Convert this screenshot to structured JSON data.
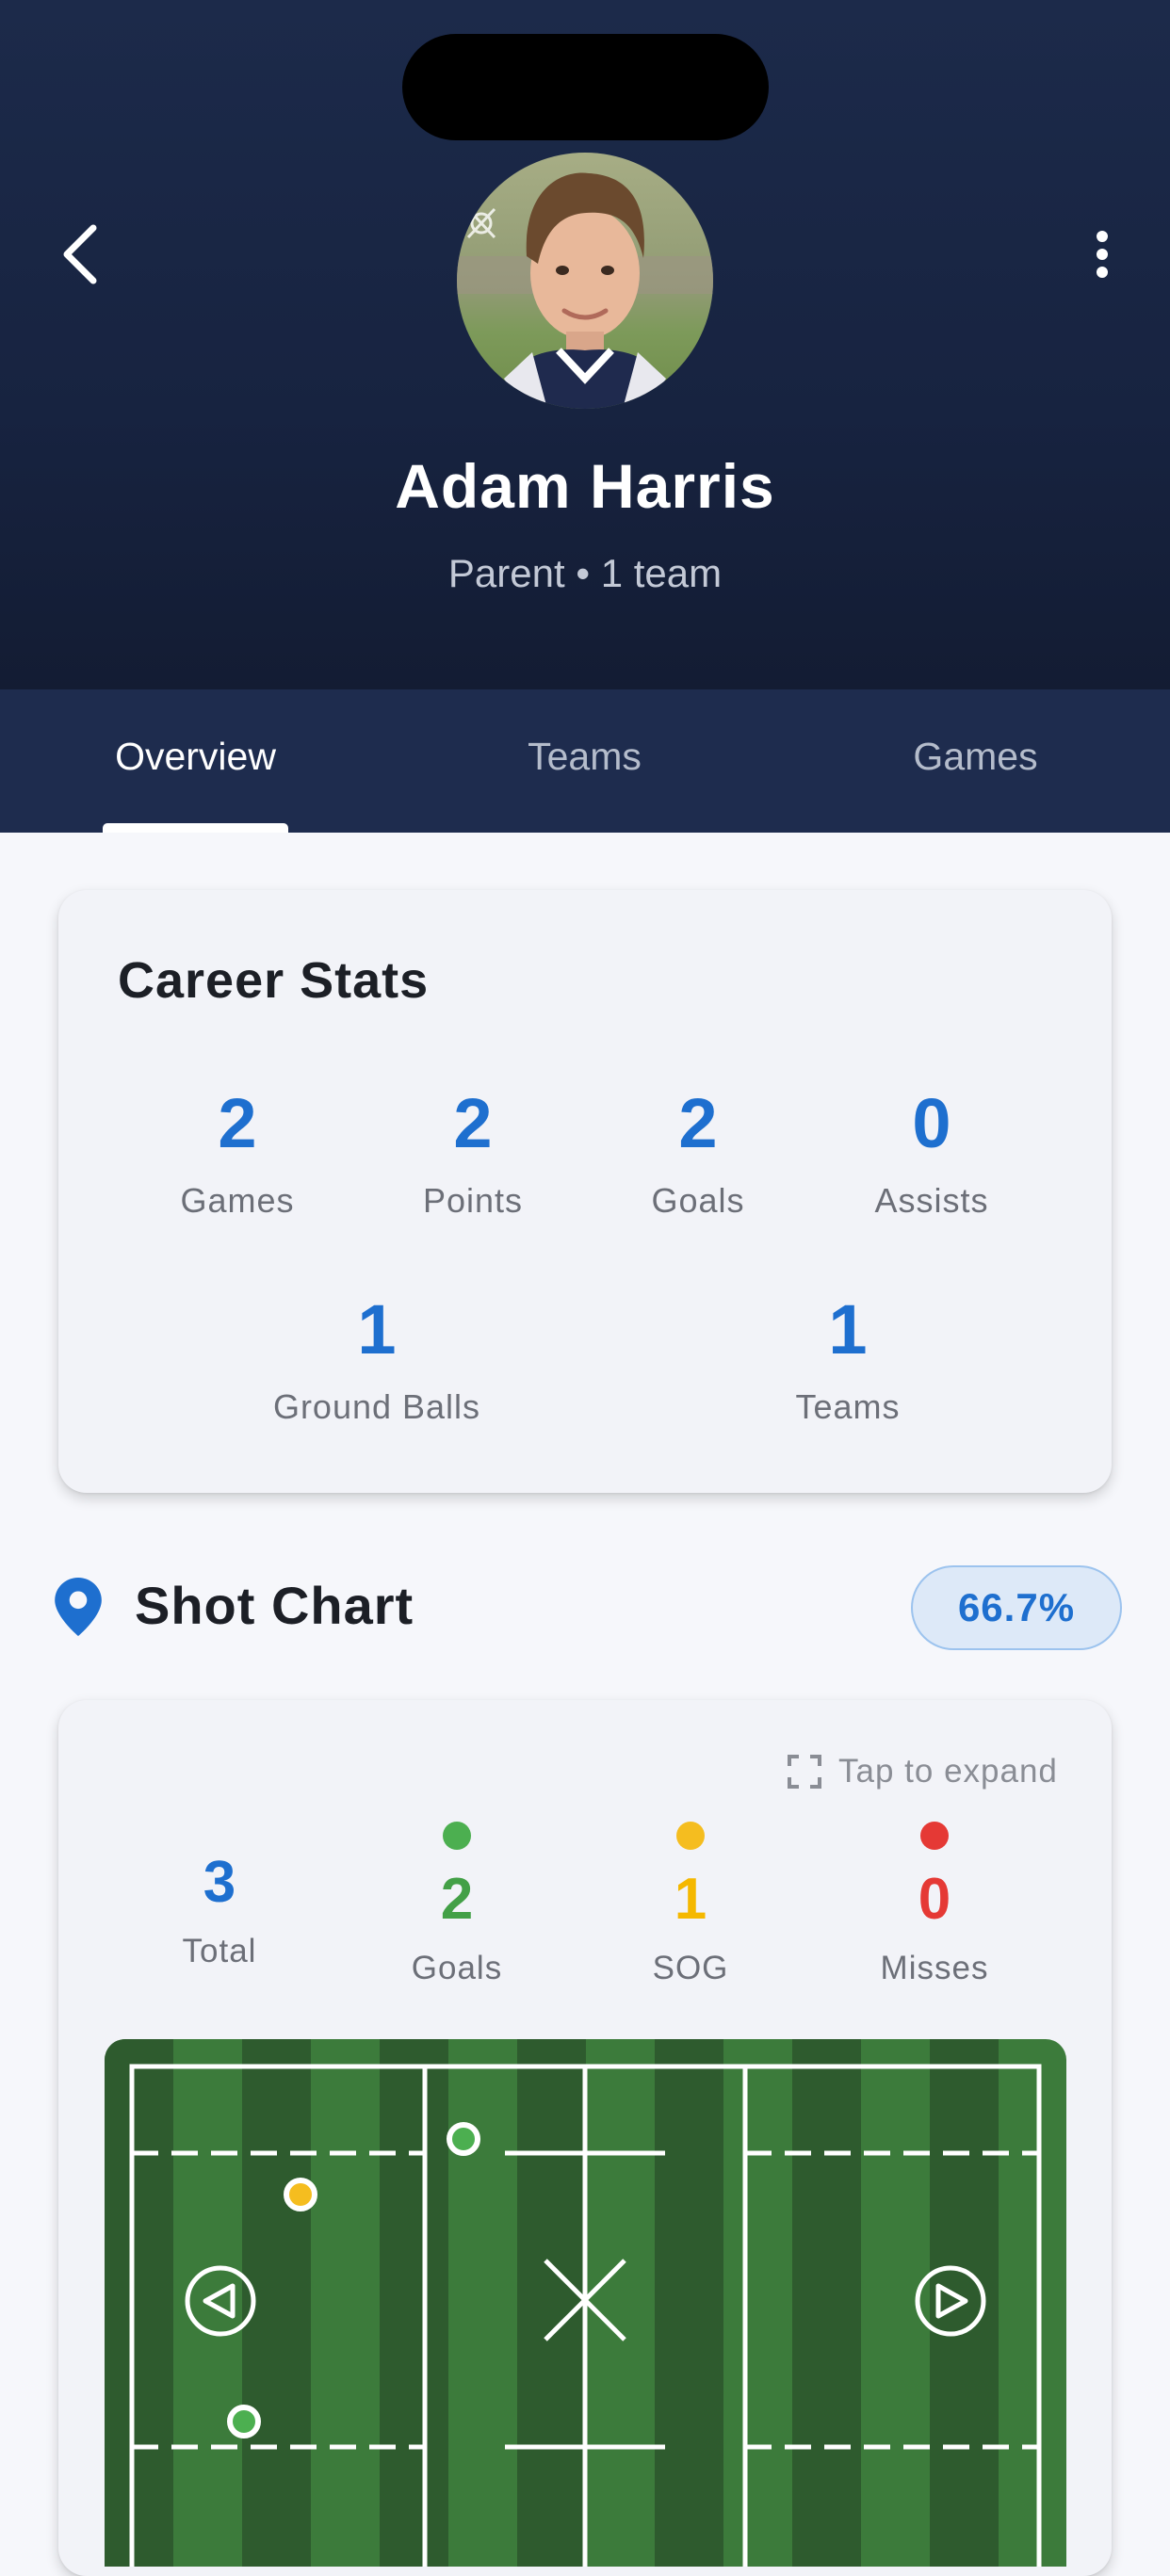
{
  "profile": {
    "name": "Adam Harris",
    "subtitle": "Parent • 1 team"
  },
  "tabs": [
    {
      "label": "Overview",
      "active": true
    },
    {
      "label": "Teams",
      "active": false
    },
    {
      "label": "Games",
      "active": false
    }
  ],
  "career_stats": {
    "title": "Career Stats",
    "row1": [
      {
        "value": "2",
        "label": "Games"
      },
      {
        "value": "2",
        "label": "Points"
      },
      {
        "value": "2",
        "label": "Goals"
      },
      {
        "value": "0",
        "label": "Assists"
      }
    ],
    "row2": [
      {
        "value": "1",
        "label": "Ground Balls"
      },
      {
        "value": "1",
        "label": "Teams"
      }
    ]
  },
  "shot_chart": {
    "title": "Shot Chart",
    "percentage": "66.7%",
    "expand_label": "Tap to expand",
    "stats": [
      {
        "value": "3",
        "label": "Total",
        "color": "#1e6fcf"
      },
      {
        "value": "2",
        "label": "Goals",
        "color": "#43a047"
      },
      {
        "value": "1",
        "label": "SOG",
        "color": "#f5bd1f"
      },
      {
        "value": "0",
        "label": "Misses",
        "color": "#e53935"
      }
    ],
    "shots": [
      {
        "result": "goal",
        "color": "#4caf50"
      },
      {
        "result": "sog",
        "color": "#f5bd1f"
      },
      {
        "result": "goal",
        "color": "#4caf50"
      }
    ]
  },
  "colors": {
    "accent": "#1e6fcf",
    "header_bg": "#1c2a4a",
    "field_dark": "#2e5b2e",
    "field_light": "#3c7b3b"
  }
}
